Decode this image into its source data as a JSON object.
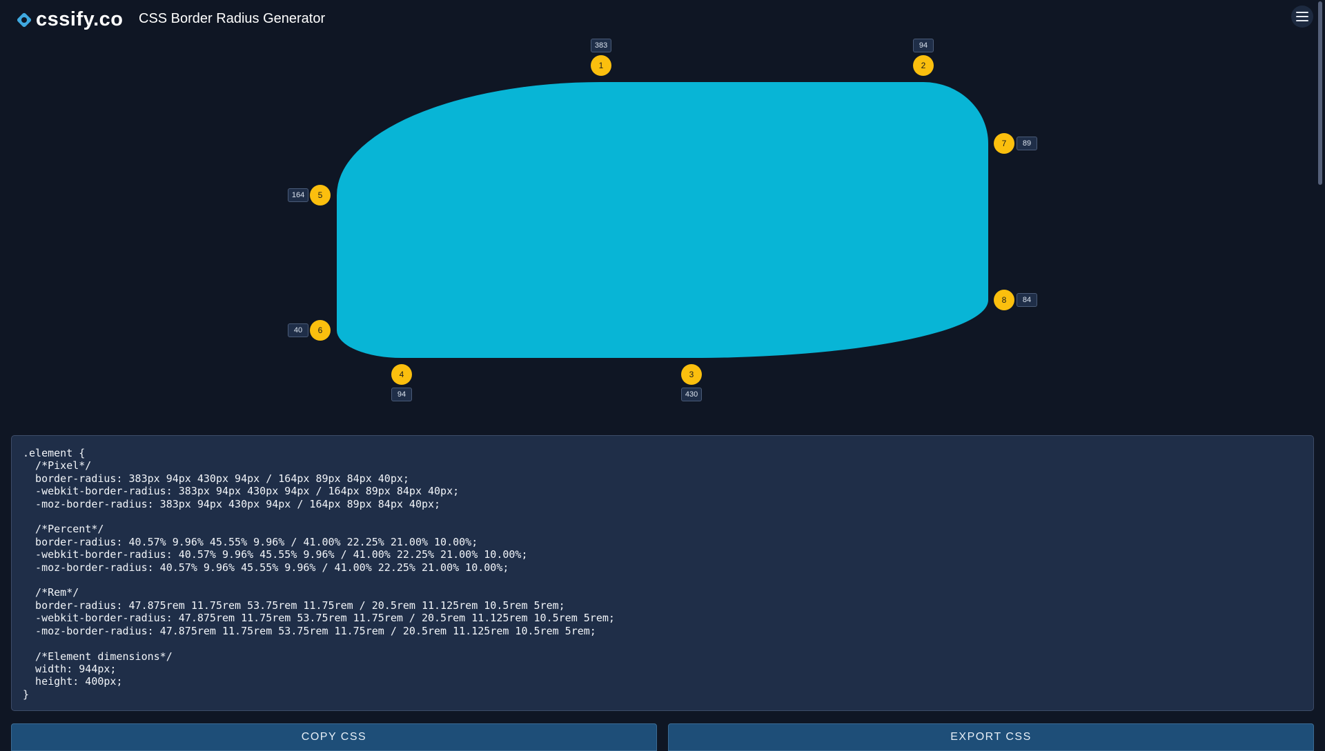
{
  "header": {
    "brand": "cssify.co",
    "title": "CSS Border Radius Generator",
    "logo_icon": "diamond-logo-icon",
    "menu_icon": "hamburger-menu-icon"
  },
  "colors": {
    "background": "#0f1624",
    "shape": "#08b5d6",
    "handle": "#fbbf0e",
    "panel": "#1f2e48",
    "button": "#1e4e78"
  },
  "handles": [
    {
      "id": "1",
      "value": "383",
      "side": "top"
    },
    {
      "id": "2",
      "value": "94",
      "side": "top"
    },
    {
      "id": "3",
      "value": "430",
      "side": "bottom"
    },
    {
      "id": "4",
      "value": "94",
      "side": "bottom"
    },
    {
      "id": "5",
      "value": "164",
      "side": "left"
    },
    {
      "id": "6",
      "value": "40",
      "side": "left"
    },
    {
      "id": "7",
      "value": "89",
      "side": "right"
    },
    {
      "id": "8",
      "value": "84",
      "side": "right"
    }
  ],
  "css_output": ".element {\n  /*Pixel*/\n  border-radius: 383px 94px 430px 94px / 164px 89px 84px 40px;\n  -webkit-border-radius: 383px 94px 430px 94px / 164px 89px 84px 40px;\n  -moz-border-radius: 383px 94px 430px 94px / 164px 89px 84px 40px;\n\n  /*Percent*/\n  border-radius: 40.57% 9.96% 45.55% 9.96% / 41.00% 22.25% 21.00% 10.00%;\n  -webkit-border-radius: 40.57% 9.96% 45.55% 9.96% / 41.00% 22.25% 21.00% 10.00%;\n  -moz-border-radius: 40.57% 9.96% 45.55% 9.96% / 41.00% 22.25% 21.00% 10.00%;\n\n  /*Rem*/\n  border-radius: 47.875rem 11.75rem 53.75rem 11.75rem / 20.5rem 11.125rem 10.5rem 5rem;\n  -webkit-border-radius: 47.875rem 11.75rem 53.75rem 11.75rem / 20.5rem 11.125rem 10.5rem 5rem;\n  -moz-border-radius: 47.875rem 11.75rem 53.75rem 11.75rem / 20.5rem 11.125rem 10.5rem 5rem;\n\n  /*Element dimensions*/\n  width: 944px;\n  height: 400px;\n}",
  "buttons": {
    "copy": "COPY CSS",
    "export": "EXPORT CSS"
  }
}
